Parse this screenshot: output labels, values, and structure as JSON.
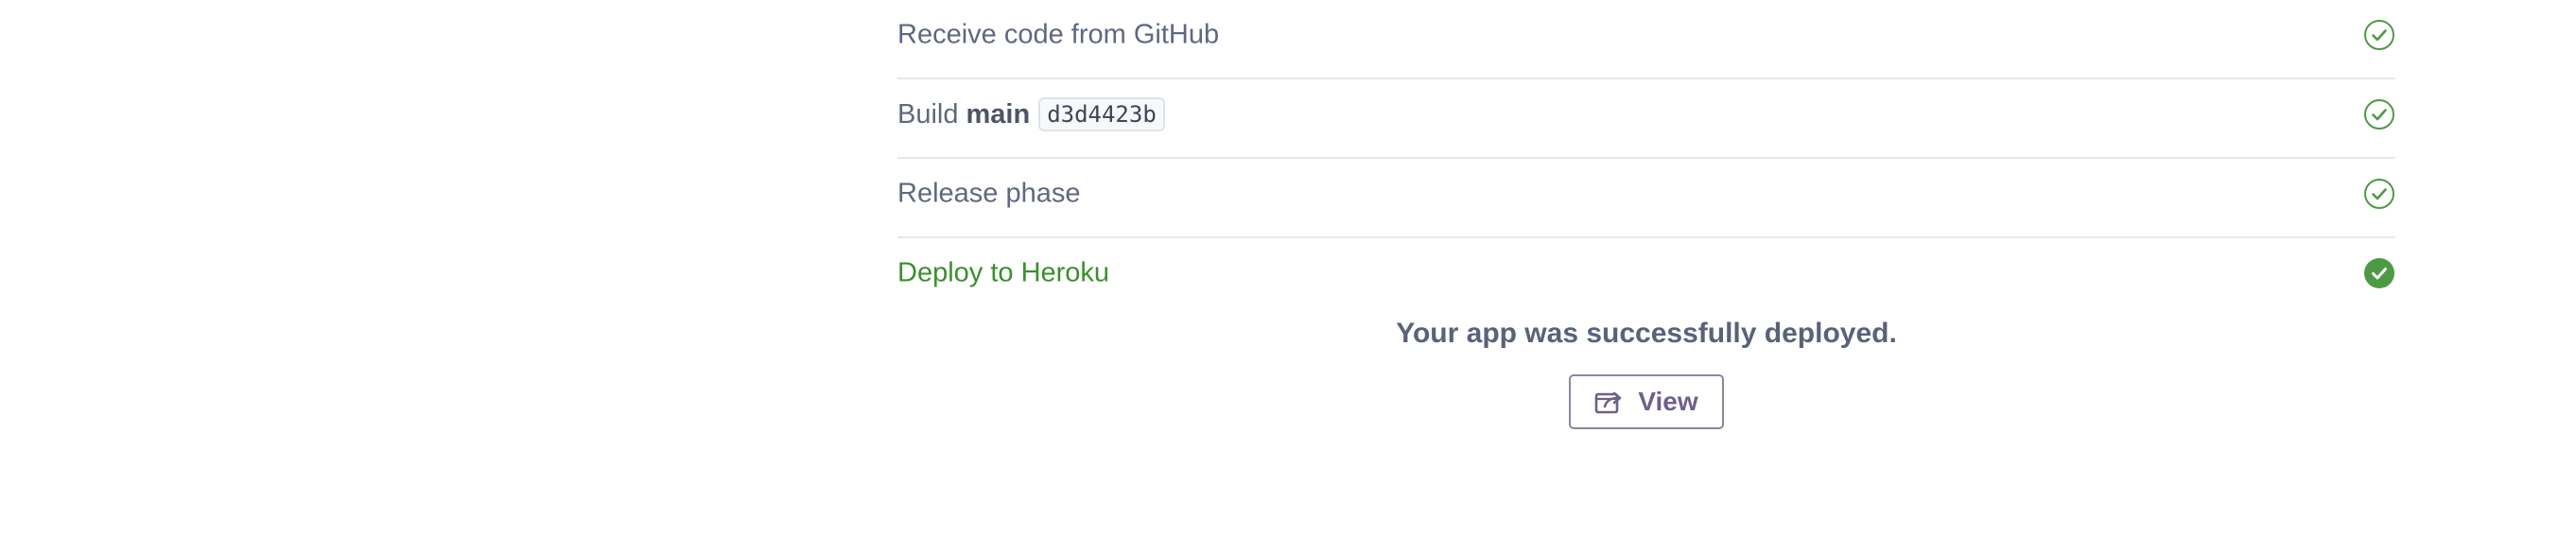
{
  "steps": [
    {
      "label": "Receive code from GitHub",
      "status": "complete",
      "icon": "check-circle-outline-icon"
    },
    {
      "label": "Build",
      "branch": "main",
      "commit": "d3d4423b",
      "status": "complete",
      "icon": "check-circle-outline-icon"
    },
    {
      "label": "Release phase",
      "status": "complete",
      "icon": "check-circle-outline-icon"
    },
    {
      "label": "Deploy to Heroku",
      "status": "success",
      "icon": "check-circle-filled-icon"
    }
  ],
  "result": {
    "message": "Your app was successfully deployed.",
    "view_button_label": "View",
    "view_button_icon": "external-link-icon"
  },
  "colors": {
    "success_green": "#3a8f2e",
    "check_green": "#4e9a44",
    "text_muted": "#5f6781",
    "button_purple": "#6f5f8c"
  }
}
